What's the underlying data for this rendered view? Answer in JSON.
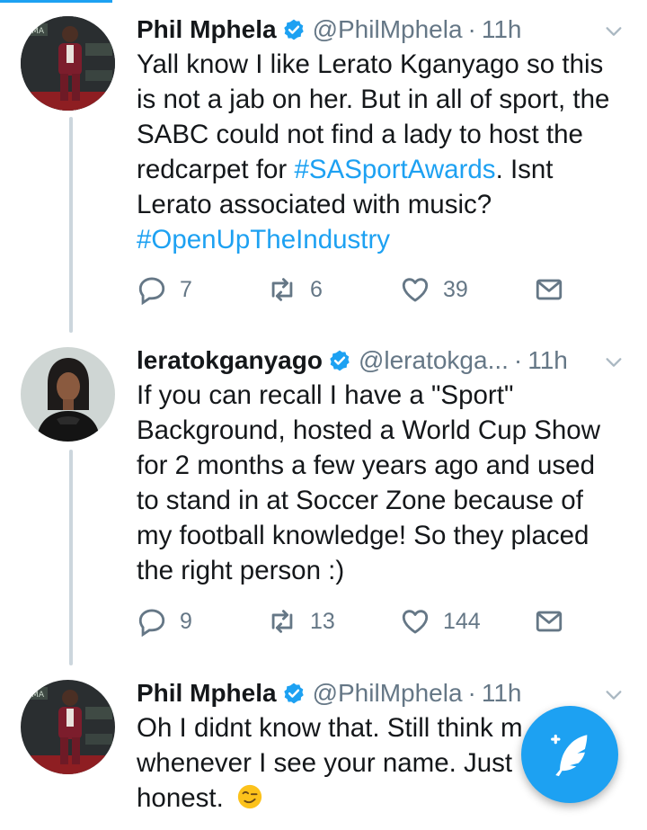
{
  "tweets": [
    {
      "name": "Phil Mphela",
      "handle": "@PhilMphela",
      "time": "11h",
      "lines": [
        [
          {
            "t": "Yall know I like Lerato Kganyago so this"
          }
        ],
        [
          {
            "t": "is not a jab on her. But in all of sport, the"
          }
        ],
        [
          {
            "t": "SABC could not find a lady to host the"
          }
        ],
        [
          {
            "t": "redcarpet for "
          },
          {
            "t": "#SASportAwards",
            "tag": true
          },
          {
            "t": ". Isnt"
          }
        ],
        [
          {
            "t": "Lerato associated with music?"
          }
        ],
        [
          {
            "t": "#OpenUpTheIndustry",
            "tag": true
          }
        ]
      ],
      "replies": "7",
      "retweets": "6",
      "likes": "39",
      "avatar_icon": "person-red-carpet-photo"
    },
    {
      "name": "leratokganyago",
      "handle": "@leratokga...",
      "time": "11h",
      "lines": [
        [
          {
            "t": "If you can recall I have a \"Sport\""
          }
        ],
        [
          {
            "t": "Background, hosted a World Cup Show"
          }
        ],
        [
          {
            "t": "for 2 months a few years ago and used"
          }
        ],
        [
          {
            "t": "to stand in at Soccer Zone because of"
          }
        ],
        [
          {
            "t": "my football knowledge! So they placed"
          }
        ],
        [
          {
            "t": "the right person :)"
          }
        ]
      ],
      "replies": "9",
      "retweets": "13",
      "likes": "144",
      "avatar_icon": "woman-portrait-photo"
    },
    {
      "name": "Phil Mphela",
      "handle": "@PhilMphela",
      "time": "11h",
      "lines": [
        [
          {
            "t": "Oh I didnt know that. Still think m"
          }
        ],
        [
          {
            "t": "whenever I see your name. Just"
          }
        ],
        [
          {
            "t": "honest. "
          }
        ]
      ],
      "emoji": "winking-smirk-emoji",
      "avatar_icon": "person-red-carpet-photo"
    }
  ],
  "icons": {
    "verified": "verified-badge-icon",
    "caret": "chevron-down-icon",
    "reply": "reply-icon",
    "retweet": "retweet-icon",
    "like": "heart-icon",
    "dm": "envelope-icon",
    "compose": "compose-tweet-icon"
  },
  "colors": {
    "accent": "#1da1f2",
    "text": "#14171a",
    "muted": "#657786",
    "thread": "#ccd6dd"
  }
}
